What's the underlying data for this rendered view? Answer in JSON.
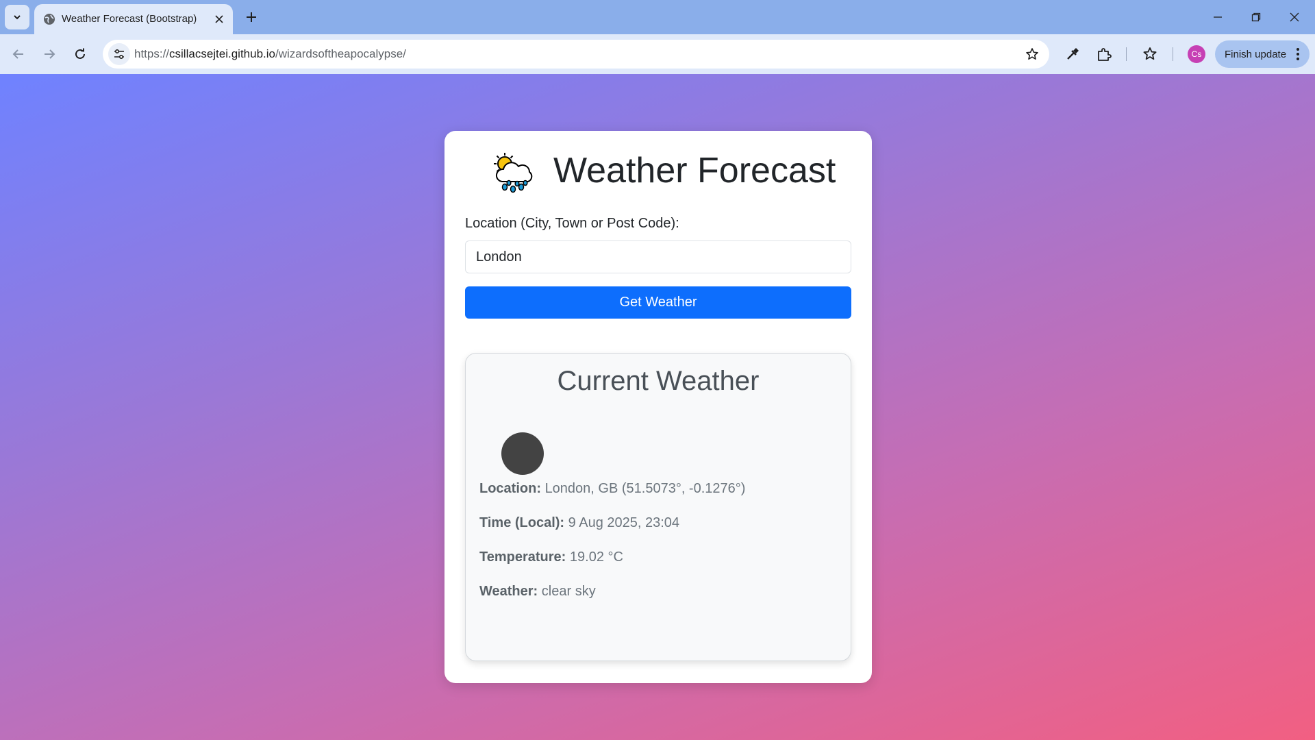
{
  "browser": {
    "tab_title": "Weather Forecast (Bootstrap)",
    "url_scheme": "https://",
    "url_host": "csillacsejtei.github.io",
    "url_path": "/wizardsoftheapocalypse/",
    "avatar_initials": "Cs",
    "update_label": "Finish update"
  },
  "page": {
    "title": "Weather Forecast",
    "location_label": "Location (City, Town or Post Code):",
    "location_value": "London",
    "button_label": "Get Weather",
    "current": {
      "heading": "Current Weather",
      "location_key": "Location:",
      "location_value": "London, GB (51.5073°, -0.1276°)",
      "time_key": "Time (Local):",
      "time_value": "9 Aug 2025, 23:04",
      "temp_key": "Temperature:",
      "temp_value": "19.02 °C",
      "weather_key": "Weather:",
      "weather_value": "clear sky"
    }
  },
  "colors": {
    "primary_button": "#0d6efd",
    "gradient_start": "#6f82ff",
    "gradient_end": "#f25f82"
  }
}
